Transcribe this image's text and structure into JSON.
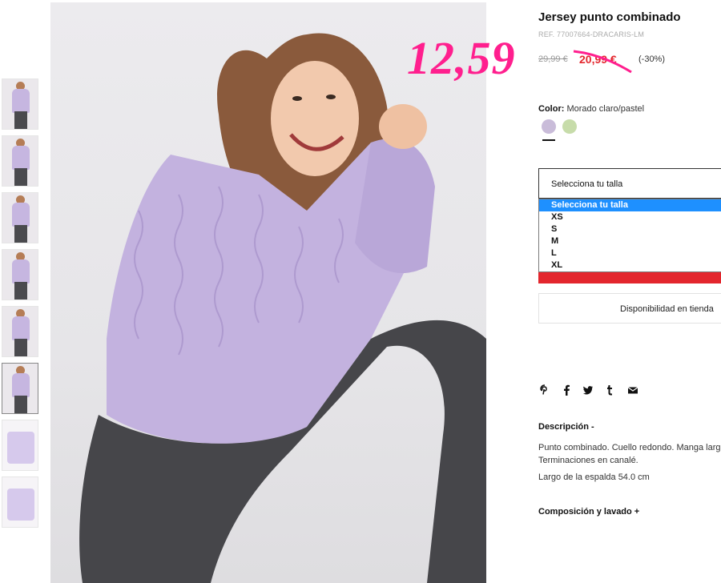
{
  "product": {
    "title": "Jersey punto combinado",
    "ref": "REF. 77007664-DRACARIS-LM",
    "price_original": "29,99 €",
    "price_sale": "20,99 €",
    "discount": "(-30%)",
    "overlay_price": "12,59"
  },
  "color": {
    "label": "Color:",
    "value": "Morado claro/pastel",
    "swatches": [
      {
        "name": "lilac",
        "hex": "#c9bcd9"
      },
      {
        "name": "green",
        "hex": "#c7dcaa"
      }
    ]
  },
  "size": {
    "placeholder": "Selecciona tu talla",
    "options": [
      "Selecciona tu talla",
      "XS",
      "S",
      "M",
      "L",
      "XL"
    ],
    "highlighted_index": 0
  },
  "availability": "Disponibilidad en tienda",
  "share_icons": [
    "pinterest-icon",
    "facebook-icon",
    "twitter-icon",
    "tumblr-icon",
    "mail-icon"
  ],
  "description": {
    "heading": "Descripción -",
    "text": "Punto combinado. Cuello redondo. Manga larga. Terminaciones en canalé.",
    "length": "Largo de la espalda 54.0 cm"
  },
  "composition": {
    "heading": "Composición y lavado +"
  },
  "thumbnails": 8,
  "colors": {
    "accent_red": "#e3262d",
    "overlay_pink": "#ff1f8e",
    "select_blue": "#1e90ff"
  }
}
